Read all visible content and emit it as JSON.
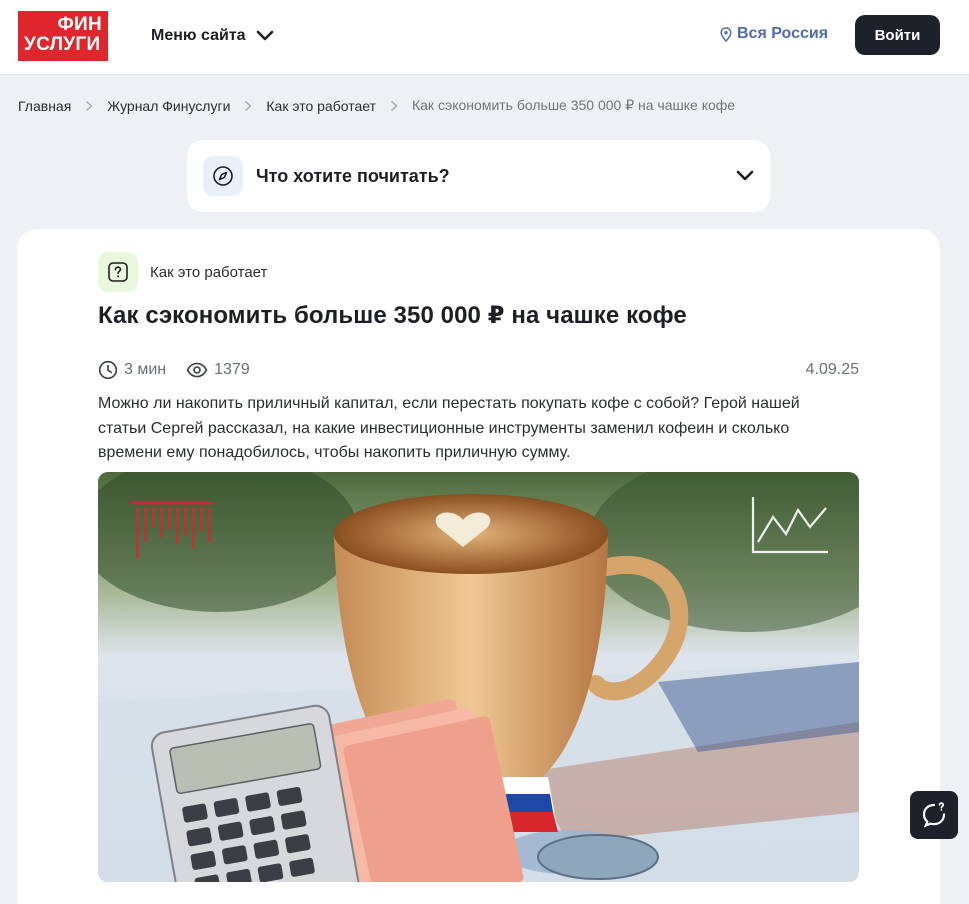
{
  "header": {
    "logo_line1": "ФИН",
    "logo_line2": "УСЛУГИ",
    "menu_label": "Меню сайта",
    "region_label": "Вся Россия",
    "login_label": "Войти"
  },
  "breadcrumb": {
    "items": [
      "Главная",
      "Журнал Финуслуги",
      "Как это работает"
    ],
    "current": "Как сэкономить больше 350 000 ₽ на чашке кофе"
  },
  "read_selector": {
    "label": "Что хотите почитать?"
  },
  "article": {
    "category": "Как это работает",
    "title": "Как сэкономить больше 350 000 ₽ на чашке кофе",
    "read_time": "3 мин",
    "views": "1379",
    "date": "4.09.25",
    "lead": "Можно ли накопить приличный капитал, если перестать покупать кофе с собой? Герой нашей статьи Сергей рассказал, на какие инвестиционные инструменты заменил кофеин и сколько времени ему понадобилось, чтобы накопить приличную сумму."
  },
  "icons": {
    "menu_chevron": "chevron-down-icon",
    "region": "location-pin-icon",
    "read_selector": "compass-icon",
    "category": "question-icon",
    "read_time": "clock-icon",
    "views": "eye-icon",
    "chat": "chat-icon"
  },
  "colors": {
    "brand_red": "#e0262d",
    "dark_button": "#1d2129",
    "region_link": "#4e6ca8",
    "page_bg": "#eef0f3"
  }
}
